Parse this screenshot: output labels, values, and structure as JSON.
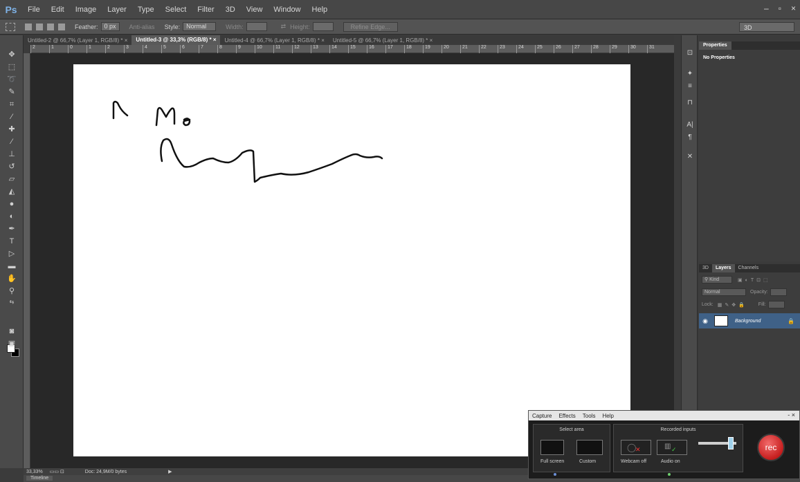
{
  "app": {
    "logo": "Ps",
    "menu": [
      "File",
      "Edit",
      "Image",
      "Layer",
      "Type",
      "Select",
      "Filter",
      "3D",
      "View",
      "Window",
      "Help"
    ],
    "window_controls": {
      "minimize": "–",
      "restore": "▫",
      "close": "×"
    }
  },
  "options": {
    "feather_label": "Feather:",
    "feather_value": "0 px",
    "antialias_label": "Anti-alias",
    "style_label": "Style:",
    "style_value": "Normal",
    "width_label": "Width:",
    "height_label": "Height:",
    "refine_edge": "Refine Edge...",
    "workspace": "3D"
  },
  "tabs": [
    {
      "label": "Untitled-2 @ 66,7% (Layer 1, RGB/8) *",
      "close": "×",
      "active": false
    },
    {
      "label": "Untitled-3 @ 33,3% (RGB/8) *",
      "close": "×",
      "active": true
    },
    {
      "label": "Untitled-4 @ 66,7% (Layer 1, RGB/8) *",
      "close": "×",
      "active": false
    },
    {
      "label": "Untitled-5 @ 66,7% (Layer 1, RGB/8) *",
      "close": "×",
      "active": false
    }
  ],
  "ruler_ticks": [
    "2",
    "1",
    "0",
    "1",
    "2",
    "3",
    "4",
    "5",
    "6",
    "7",
    "8",
    "9",
    "10",
    "11",
    "12",
    "13",
    "14",
    "15",
    "16",
    "17",
    "18",
    "19",
    "20",
    "21",
    "22",
    "23",
    "24",
    "25",
    "26",
    "27",
    "28",
    "29",
    "30",
    "31"
  ],
  "status": {
    "zoom": "33,33%",
    "doc": "Doc: 24,9M/0 bytes",
    "arrow": "▶"
  },
  "timeline": "Timeline",
  "properties": {
    "tab": "Properties",
    "text": "No Properties"
  },
  "layers": {
    "tabs": [
      "3D",
      "Layers",
      "Channels"
    ],
    "kind": "Kind",
    "blend_mode": "Normal",
    "opacity_label": "Opacity:",
    "lock_label": "Lock:",
    "fill_label": "Fill:",
    "layer_name": "Background",
    "eye": "◉",
    "lock_icon": "🔒"
  },
  "capture": {
    "menu": [
      "Capture",
      "Effects",
      "Tools",
      "Help"
    ],
    "close": "- ×",
    "select_area": "Select area",
    "full_screen": "Full screen",
    "custom": "Custom",
    "recorded_inputs": "Recorded inputs",
    "webcam_off": "Webcam off",
    "audio_on": "Audio on",
    "rec": "rec"
  },
  "colors": {
    "foreground": "#ffffff",
    "background": "#000000",
    "rec_button": "#c61e1e",
    "selected_layer": "#3f6187"
  }
}
